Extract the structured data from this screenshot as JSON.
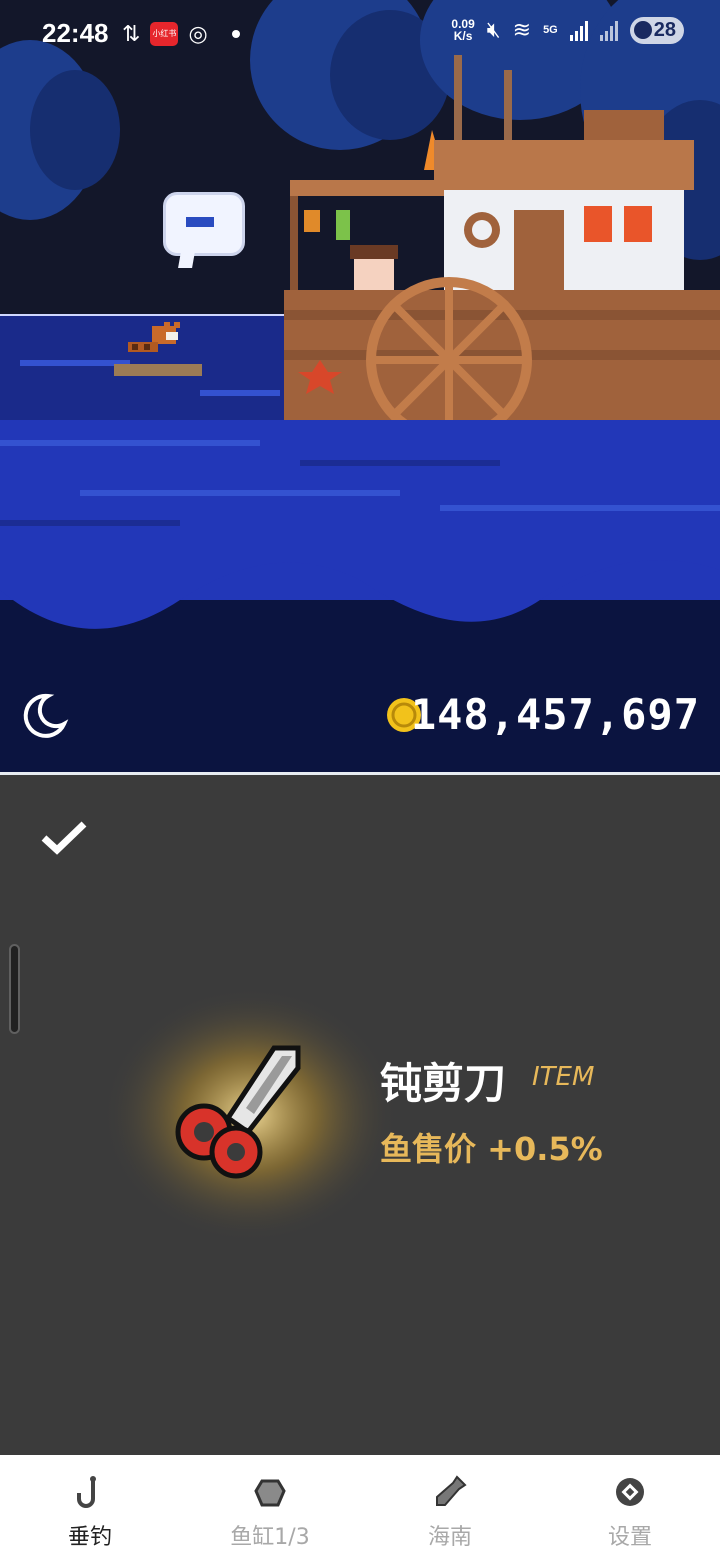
{
  "status_bar": {
    "time": "22:48",
    "app_badge": "小红书",
    "net_speed_value": "0.09",
    "net_speed_unit": "K/s",
    "network_type": "5G",
    "battery": "28"
  },
  "game": {
    "coins": "148,457,697"
  },
  "item": {
    "name": "钝剪刀",
    "tag": "ITEM",
    "effect": "鱼售价 +0.5%"
  },
  "nav": {
    "items": [
      {
        "label": "垂钓",
        "icon": "fishing-hook-icon",
        "active": true
      },
      {
        "label": "鱼缸1/3",
        "icon": "fish-tank-icon",
        "active": false
      },
      {
        "label": "海南",
        "icon": "bottle-icon",
        "active": false
      },
      {
        "label": "设置",
        "icon": "settings-icon",
        "active": false
      }
    ]
  },
  "colors": {
    "accent_gold": "#e7b85a",
    "panel_bg": "#3b3b3b",
    "water": "#2237b8"
  }
}
